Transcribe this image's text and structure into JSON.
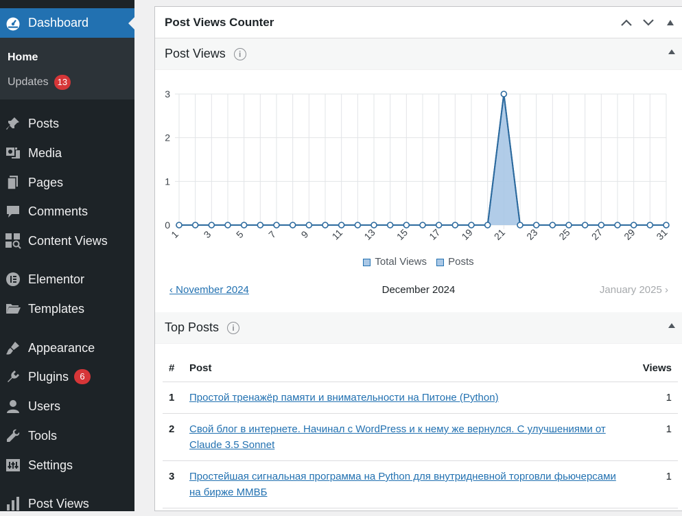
{
  "sidebar": {
    "dashboard": "Dashboard",
    "home": "Home",
    "updates": "Updates",
    "updates_count": "13",
    "items": [
      {
        "label": "Posts",
        "icon": "pin-icon"
      },
      {
        "label": "Media",
        "icon": "media-icon"
      },
      {
        "label": "Pages",
        "icon": "pages-icon"
      },
      {
        "label": "Comments",
        "icon": "comment-icon"
      },
      {
        "label": "Content Views",
        "icon": "grid-search-icon"
      },
      {
        "label": "Elementor",
        "icon": "elementor-icon"
      },
      {
        "label": "Templates",
        "icon": "folder-icon"
      },
      {
        "label": "Appearance",
        "icon": "brush-icon"
      },
      {
        "label": "Plugins",
        "icon": "plug-icon",
        "badge": "6"
      },
      {
        "label": "Users",
        "icon": "user-icon"
      },
      {
        "label": "Tools",
        "icon": "wrench-icon"
      },
      {
        "label": "Settings",
        "icon": "settings-icon"
      },
      {
        "label": "Post Views",
        "icon": "bar-chart-icon"
      }
    ]
  },
  "panel": {
    "title": "Post Views Counter",
    "post_views": {
      "title": "Post Views",
      "nav_prev": "‹ November 2024",
      "nav_current": "December 2024",
      "nav_next": "January 2025 ›"
    },
    "top_posts": {
      "title": "Top Posts",
      "headers": {
        "num": "#",
        "post": "Post",
        "views": "Views"
      },
      "rows": [
        {
          "num": "1",
          "title": "Простой тренажёр памяти и внимательности на Питоне (Python)",
          "views": "1"
        },
        {
          "num": "2",
          "title": "Свой блог в интернете. Начинал с WordPress и к нему же вернулся. С улучшениями от Claude 3.5 Sonnet",
          "views": "1"
        },
        {
          "num": "3",
          "title": "Простейшая сигнальная программа на Python для внутридневной торговли фьючерсами на бирже ММВБ",
          "views": "1"
        }
      ]
    }
  },
  "colors": {
    "accent": "#2271b1",
    "sidebar": "#1d2327",
    "badge": "#d63638",
    "area_fill": "#aac8e6"
  },
  "chart_data": {
    "type": "area",
    "x": [
      1,
      2,
      3,
      4,
      5,
      6,
      7,
      8,
      9,
      10,
      11,
      12,
      13,
      14,
      15,
      16,
      17,
      18,
      19,
      20,
      21,
      22,
      23,
      24,
      25,
      26,
      27,
      28,
      29,
      30,
      31
    ],
    "x_tick_labels": [
      "1",
      "3",
      "5",
      "7",
      "9",
      "11",
      "13",
      "15",
      "17",
      "19",
      "21",
      "23",
      "25",
      "27",
      "29",
      "31"
    ],
    "series": [
      {
        "name": "Total Views",
        "values": [
          0,
          0,
          0,
          0,
          0,
          0,
          0,
          0,
          0,
          0,
          0,
          0,
          0,
          0,
          0,
          0,
          0,
          0,
          0,
          0,
          3,
          0,
          0,
          0,
          0,
          0,
          0,
          0,
          0,
          0,
          0
        ]
      },
      {
        "name": "Posts",
        "values": [
          0,
          0,
          0,
          0,
          0,
          0,
          0,
          0,
          0,
          0,
          0,
          0,
          0,
          0,
          0,
          0,
          0,
          0,
          0,
          0,
          3,
          0,
          0,
          0,
          0,
          0,
          0,
          0,
          0,
          0,
          0
        ]
      }
    ],
    "ylim": [
      0,
      3
    ],
    "y_ticks": [
      "0",
      "1",
      "2",
      "3"
    ],
    "grid": true,
    "legend": "bottom"
  }
}
